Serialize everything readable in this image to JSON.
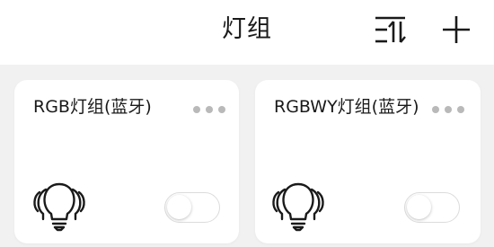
{
  "header": {
    "title": "灯组",
    "sort_icon": "sort-icon",
    "add_icon": "plus-icon"
  },
  "groups": [
    {
      "name": "RGB灯组(蓝牙)",
      "icon": "bulb-icon",
      "more_icon": "more-dots-icon",
      "switch_on": false
    },
    {
      "name": "RGBWY灯组(蓝牙)",
      "icon": "bulb-icon",
      "more_icon": "more-dots-icon",
      "switch_on": false
    }
  ],
  "colors": {
    "background": "#f1f1f1",
    "card": "#ffffff",
    "text": "#1a1a1a",
    "dots": "#b9b9b9",
    "toggle_border": "#dcdcdc"
  }
}
